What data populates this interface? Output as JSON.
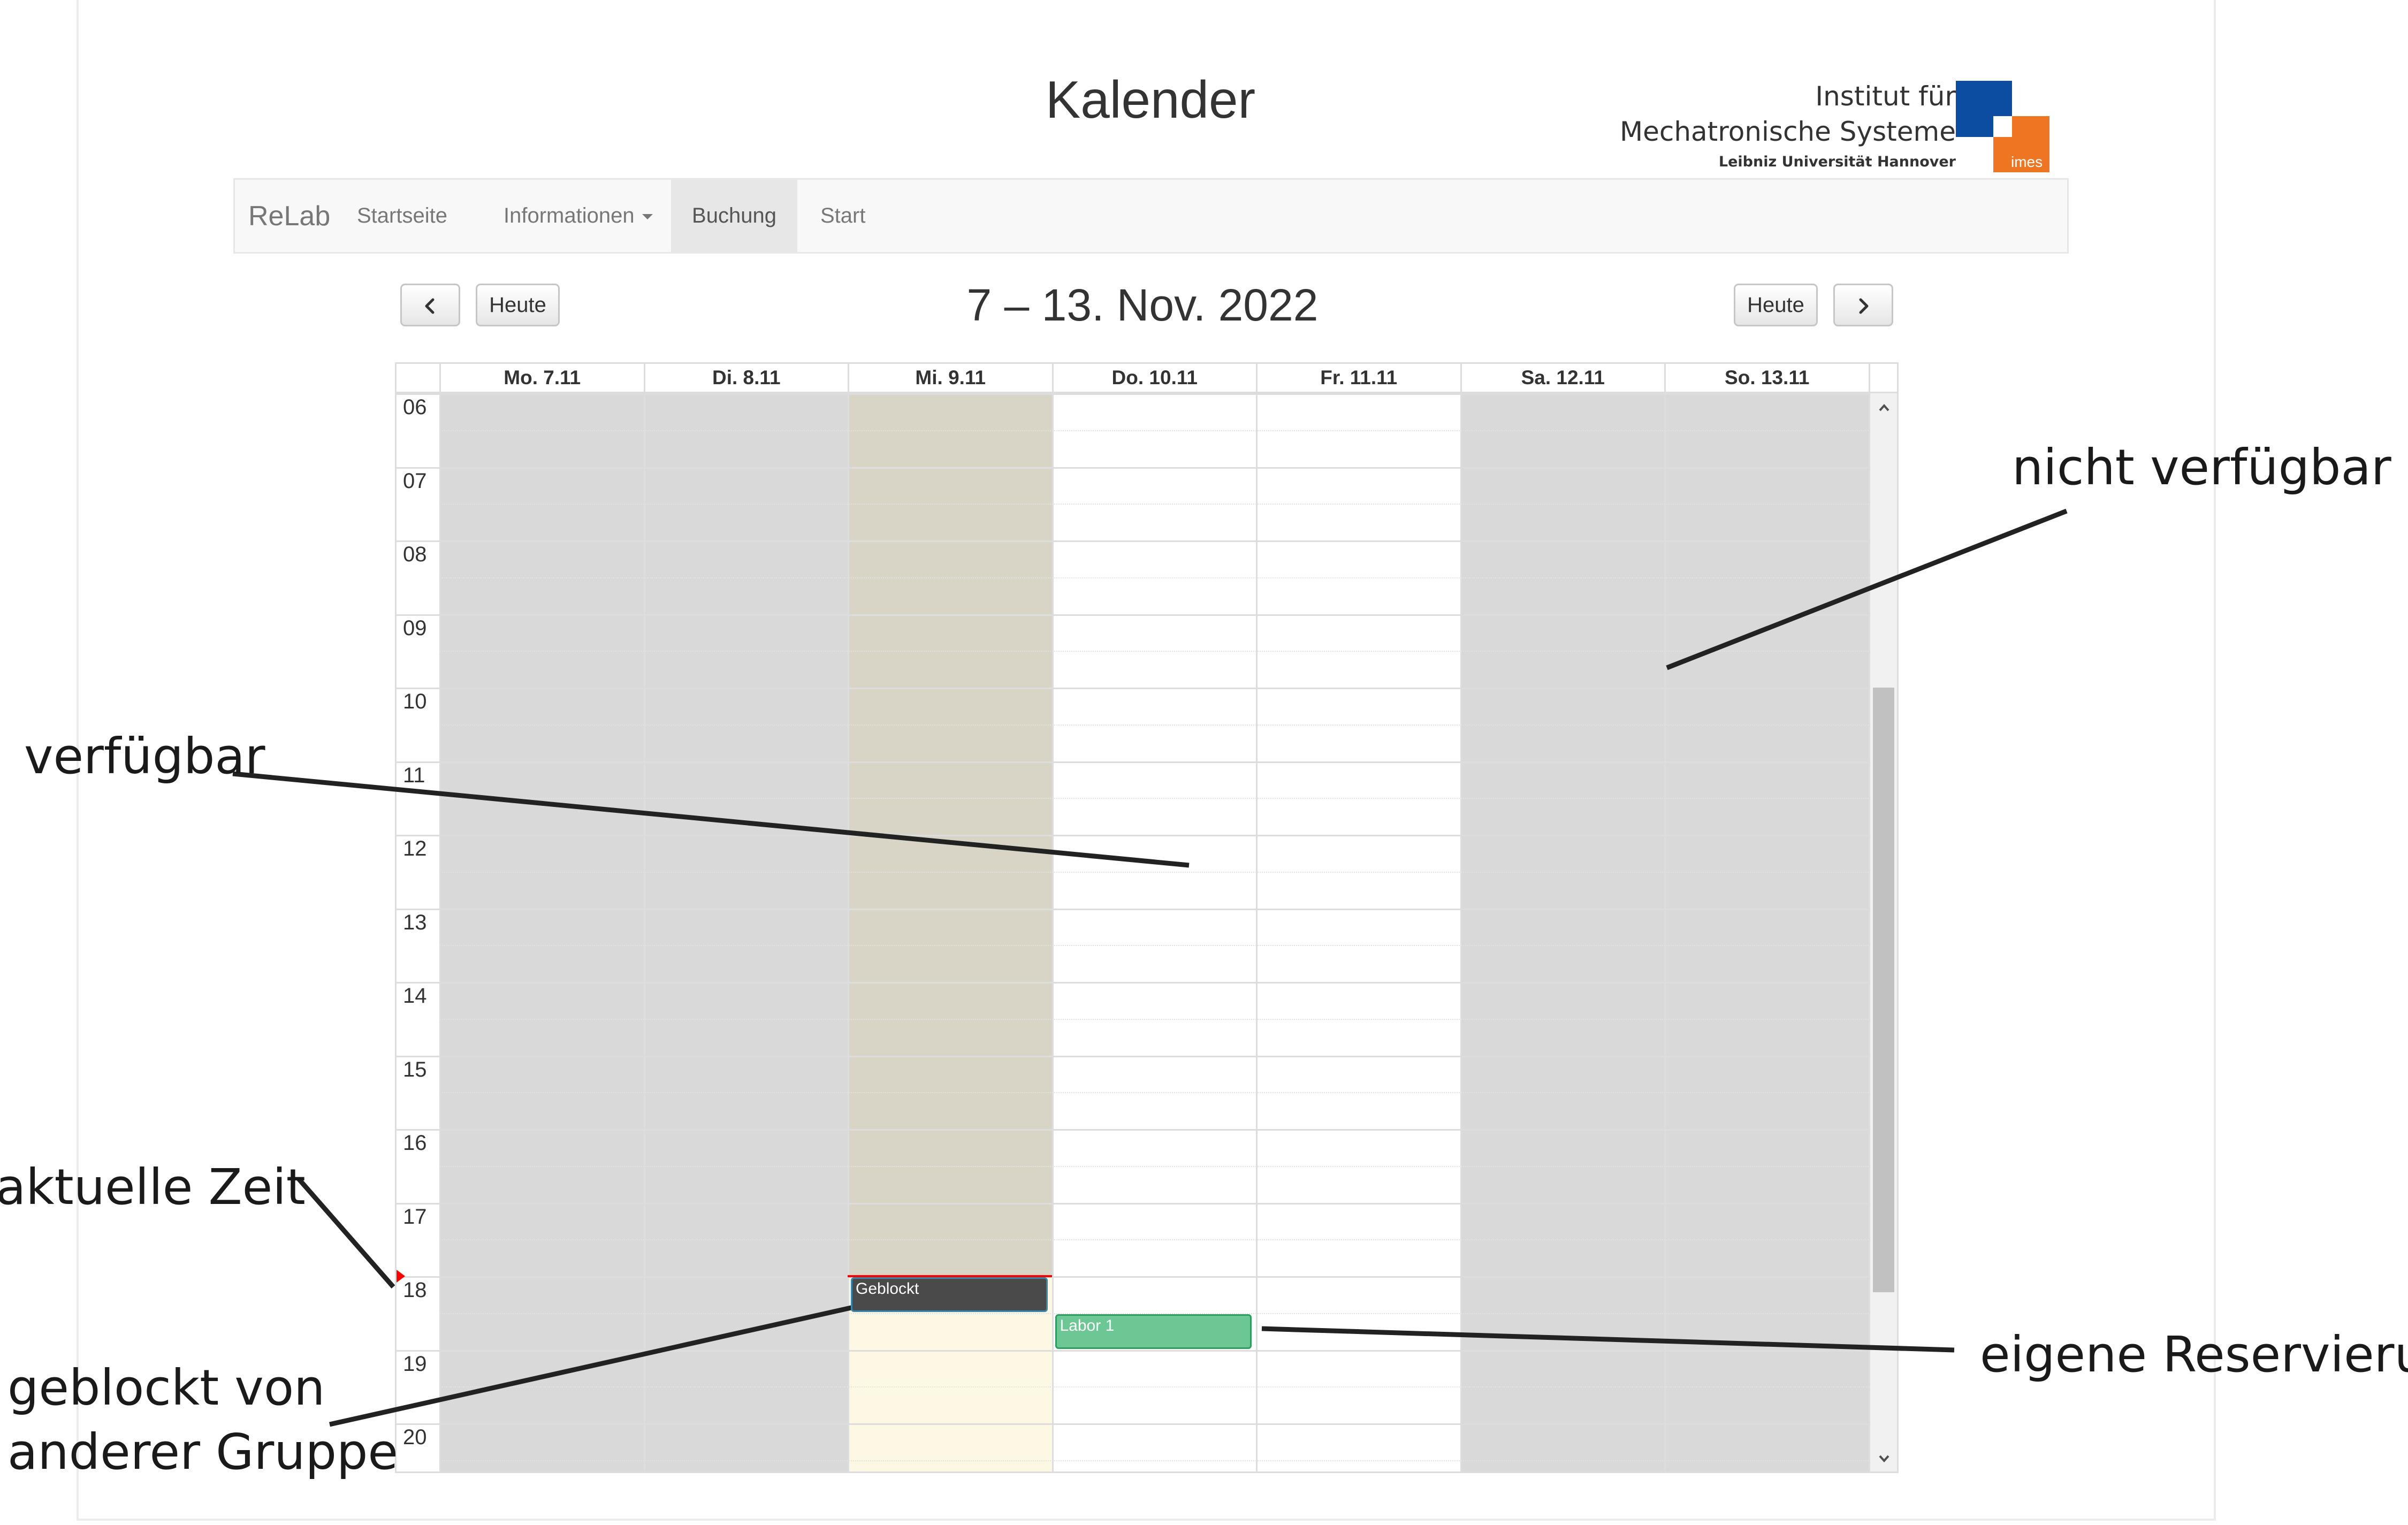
{
  "page": {
    "title": "Kalender"
  },
  "logo": {
    "line1": "Institut für",
    "line2": "Mechatronische Systeme",
    "line3": "Leibniz Universität Hannover",
    "mark": "imes",
    "colors": {
      "blue": "#0d4da1",
      "orange": "#ee7623"
    }
  },
  "navbar": {
    "brand": "ReLab",
    "items": [
      {
        "label": "Startseite",
        "active": false
      },
      {
        "label": "Informationen",
        "active": false,
        "dropdown": true
      },
      {
        "label": "Buchung",
        "active": true
      },
      {
        "label": "Start",
        "active": false
      }
    ]
  },
  "toolbar": {
    "prev_icon": "chevron-left-icon",
    "next_icon": "chevron-right-icon",
    "today_label": "Heute",
    "range_title": "7 – 13. Nov. 2022"
  },
  "calendar": {
    "days": [
      {
        "label": "Mo. 7.11",
        "state": "unavailable"
      },
      {
        "label": "Di. 8.11",
        "state": "unavailable"
      },
      {
        "label": "Mi. 9.11",
        "state": "today"
      },
      {
        "label": "Do. 10.11",
        "state": "available"
      },
      {
        "label": "Fr. 11.11",
        "state": "available"
      },
      {
        "label": "Sa. 12.11",
        "state": "unavailable"
      },
      {
        "label": "So. 13.11",
        "state": "unavailable"
      }
    ],
    "hours": [
      "06",
      "07",
      "08",
      "09",
      "10",
      "11",
      "12",
      "13",
      "14",
      "15",
      "16",
      "17",
      "18",
      "19",
      "20"
    ],
    "first_hour": 6,
    "now": {
      "day_index": 2,
      "time": 18.0,
      "past_color": "#d8d5c6",
      "future_color": "#fcf8e3",
      "line_color": "#ff0000"
    },
    "events": [
      {
        "title": "Geblockt",
        "day_index": 2,
        "start": 18.0,
        "end": 18.5,
        "color": "#4a4a4a",
        "border": "#3a87ad"
      },
      {
        "title": "Labor 1",
        "day_index": 3,
        "start": 18.5,
        "end": 19.0,
        "color": "#6cc794",
        "border": "#2e9e5e"
      }
    ],
    "colors": {
      "unavailable": "#d9d9d9",
      "available": "#ffffff"
    }
  },
  "annotations": {
    "nicht_verfuegbar": "nicht verfügbar",
    "verfuegbar": "verfügbar",
    "aktuelle_zeit": "aktuelle Zeit",
    "eigene_reservierung": "eigene Reservierung",
    "geblockt_line1": "geblockt von",
    "geblockt_line2": "anderer Gruppe"
  }
}
